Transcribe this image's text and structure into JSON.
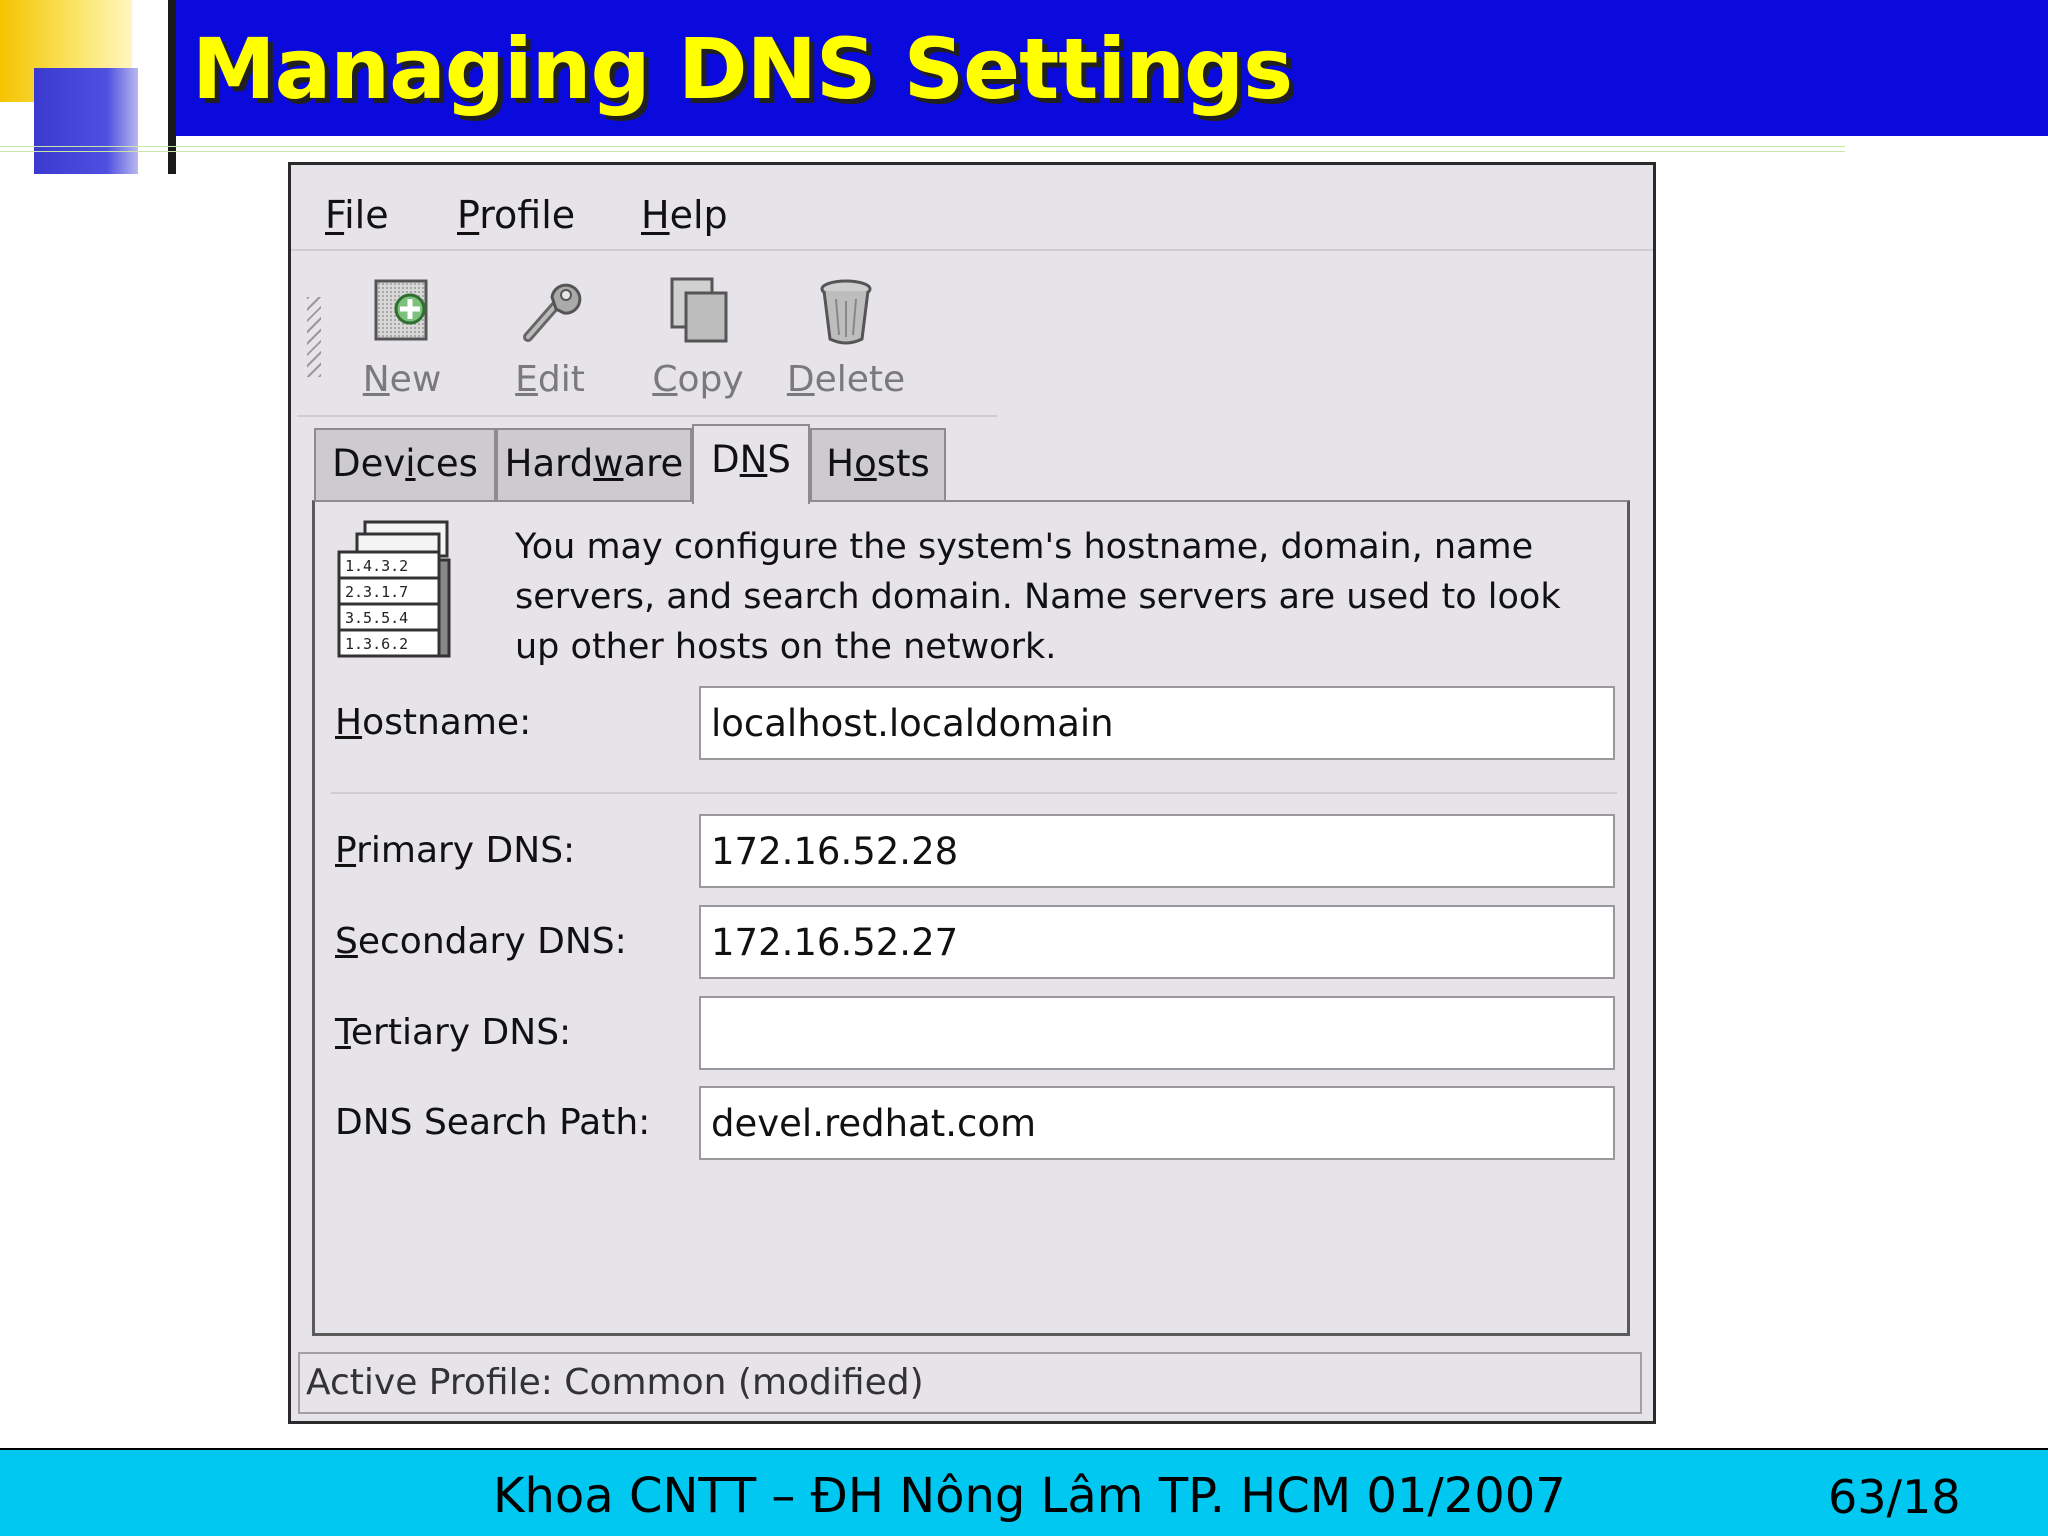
{
  "slide": {
    "title": "Managing DNS Settings",
    "footer_text": "Khoa CNTT – ĐH Nông Lâm TP. HCM 01/2007",
    "page_number": "63/18"
  },
  "window": {
    "menu": [
      {
        "accel": "F",
        "rest": "ile"
      },
      {
        "accel": "P",
        "rest": "rofile"
      },
      {
        "accel": "H",
        "rest": "elp"
      }
    ],
    "toolbar": {
      "new_label_accel": "N",
      "new_label_rest": "ew",
      "edit_label_accel": "E",
      "edit_label_rest": "dit",
      "copy_label_accel": "C",
      "copy_label_rest": "opy",
      "delete_label_accel": "D",
      "delete_label_rest": "elete"
    },
    "tabs": {
      "devices_pre": "Dev",
      "devices_accel": "i",
      "devices_post": "ces",
      "hardware_pre": "Hard",
      "hardware_accel": "w",
      "hardware_post": "are",
      "dns_pre": "D",
      "dns_accel": "N",
      "dns_post": "S",
      "hosts_pre": "H",
      "hosts_accel": "o",
      "hosts_post": "sts",
      "active": "DNS"
    },
    "dns_icon_rows": [
      "1.4.3.2",
      "2.3.1.7",
      "3.5.5.4",
      "1.3.6.2"
    ],
    "info_text": "You may configure the system's hostname, domain, name servers, and search domain. Name servers are used to look up other hosts on the network.",
    "fields": {
      "hostname_accel": "H",
      "hostname_rest": "ostname:",
      "hostname_value": "localhost.localdomain",
      "primary_accel": "P",
      "primary_rest": "rimary DNS:",
      "primary_value": "172.16.52.28",
      "secondary_accel": "S",
      "secondary_rest": "econdary DNS:",
      "secondary_value": "172.16.52.27",
      "tertiary_accel": "T",
      "tertiary_rest": "ertiary DNS:",
      "tertiary_value": "",
      "search_label": "DNS Search Path:",
      "search_value": "devel.redhat.com"
    },
    "status": "Active Profile: Common (modified)"
  },
  "colors": {
    "title_band": "#0a0adc",
    "title_text": "#ffff00",
    "footer_band": "#00c8f0",
    "window_bg": "#e6e4e8"
  }
}
